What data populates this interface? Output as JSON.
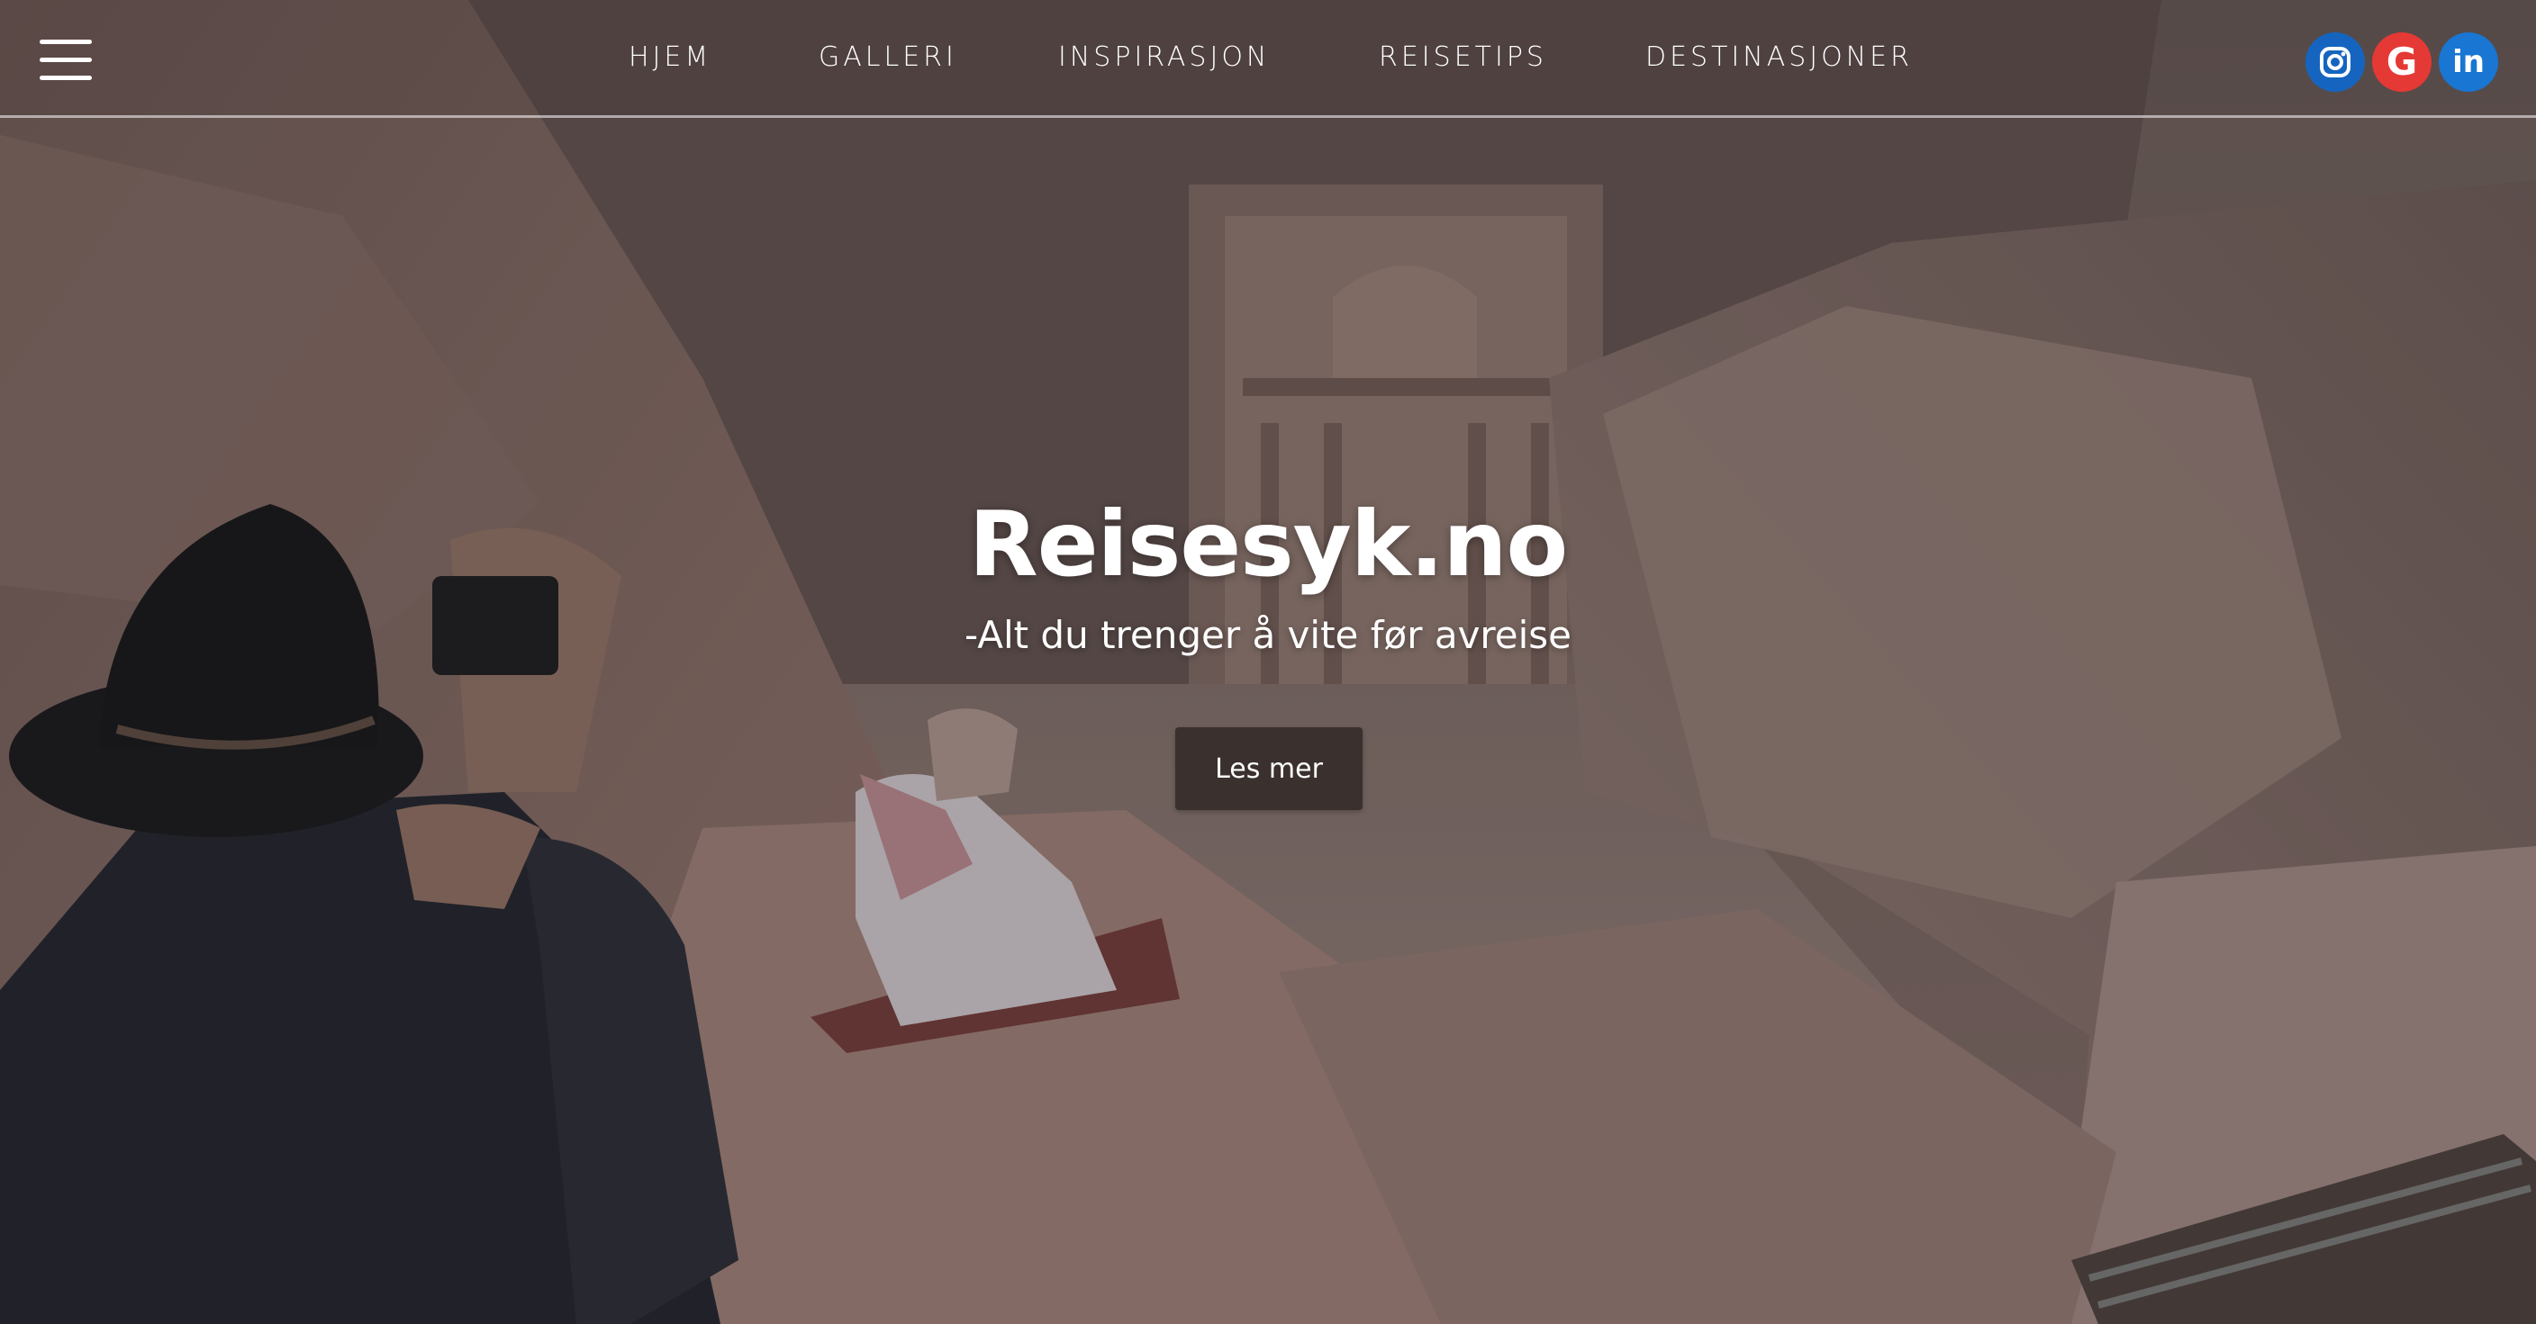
{
  "nav": {
    "items": [
      {
        "label": "HJEM"
      },
      {
        "label": "GALLERI"
      },
      {
        "label": "INSPIRASJON"
      },
      {
        "label": "REISETIPS"
      },
      {
        "label": "DESTINASJONER"
      }
    ]
  },
  "social": {
    "items": [
      {
        "icon": "instagram-icon",
        "color": "#1565c0"
      },
      {
        "icon": "google-icon",
        "color": "#e53935",
        "glyph": "G"
      },
      {
        "icon": "linkedin-icon",
        "color": "#1976d2",
        "glyph": "in"
      }
    ]
  },
  "hero": {
    "title": "Reisesyk.no",
    "subtitle": "-Alt du trenger å vite før avreise",
    "cta_label": "Les mer"
  },
  "colors": {
    "button_bg": "#3a302d",
    "text": "#ffffff",
    "rock": "#8a7470"
  }
}
